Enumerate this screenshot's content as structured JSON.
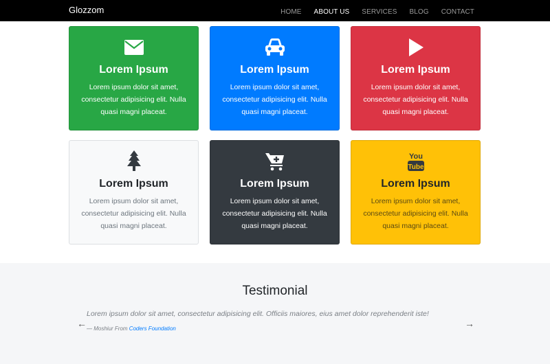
{
  "navbar": {
    "brand": "Glozzom",
    "links": [
      {
        "label": "HOME",
        "active": false
      },
      {
        "label": "ABOUT US",
        "active": true
      },
      {
        "label": "SERVICES",
        "active": false
      },
      {
        "label": "BLOG",
        "active": false
      },
      {
        "label": "CONTACT",
        "active": false
      }
    ]
  },
  "cards": [
    {
      "icon": "envelope-icon",
      "title": "Lorem Ipsum",
      "text": "Lorem ipsum dolor sit amet, consectetur adipisicing elit. Nulla quasi magni placeat.",
      "bg": "#28a745"
    },
    {
      "icon": "car-icon",
      "title": "Lorem Ipsum",
      "text": "Lorem ipsum dolor sit amet, consectetur adipisicing elit. Nulla quasi magni placeat.",
      "bg": "#007bff"
    },
    {
      "icon": "play-icon",
      "title": "Lorem Ipsum",
      "text": "Lorem ipsum dolor sit amet, consectetur adipisicing elit. Nulla quasi magni placeat.",
      "bg": "#dc3545"
    },
    {
      "icon": "tree-icon",
      "title": "Lorem Ipsum",
      "text": "Lorem ipsum dolor sit amet, consectetur adipisicing elit. Nulla quasi magni placeat.",
      "bg": "#f8f9fa"
    },
    {
      "icon": "cart-plus-icon",
      "title": "Lorem Ipsum",
      "text": "Lorem ipsum dolor sit amet, consectetur adipisicing elit. Nulla quasi magni placeat.",
      "bg": "#343a40"
    },
    {
      "icon": "youtube-icon",
      "title": "Lorem Ipsum",
      "text": "Lorem ipsum dolor sit amet, consectetur adipisicing elit. Nulla quasi magni placeat.",
      "bg": "#ffc107"
    }
  ],
  "testimonial": {
    "heading": "Testimonial",
    "quote": "Lorem ipsum dolor sit amet, consectetur adipisicing elit. Officiis maiores, eius amet dolor reprehenderit iste!",
    "author_prefix": "— Moshiur From",
    "author_link": "Coders Foundation",
    "prev_arrow": "←",
    "next_arrow": "→"
  },
  "youtube_icon_text": {
    "top": "You",
    "bottom": "Tube"
  }
}
